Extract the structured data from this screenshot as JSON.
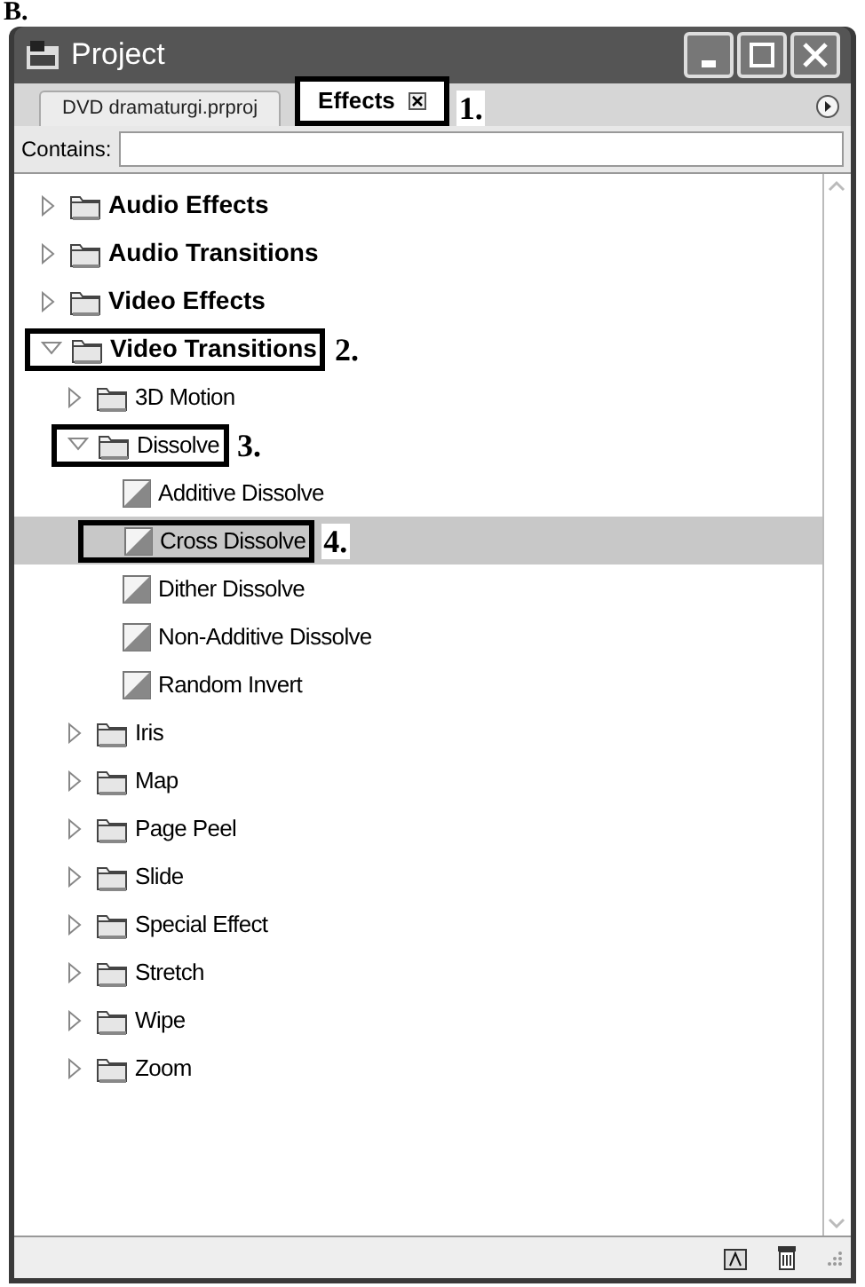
{
  "figure_label": "B.",
  "window": {
    "title": "Project"
  },
  "tabs": [
    {
      "label": "DVD dramaturgi.prproj",
      "selected": false,
      "closable": false
    },
    {
      "label": "Effects",
      "selected": true,
      "closable": true,
      "callout": "1."
    }
  ],
  "search": {
    "label": "Contains:"
  },
  "tree": [
    {
      "label": "Audio Effects",
      "kind": "folder",
      "expanded": false,
      "selected": false
    },
    {
      "label": "Audio Transitions",
      "kind": "folder",
      "expanded": false,
      "selected": false
    },
    {
      "label": "Video Effects",
      "kind": "folder",
      "expanded": false,
      "selected": false
    },
    {
      "label": "Video Transitions",
      "kind": "folder",
      "expanded": true,
      "selected": false,
      "callout": "2.",
      "children": [
        {
          "label": "3D Motion",
          "kind": "folder",
          "expanded": false,
          "selected": false
        },
        {
          "label": "Dissolve",
          "kind": "folder",
          "expanded": true,
          "selected": false,
          "callout": "3.",
          "children": [
            {
              "label": "Additive Dissolve",
              "kind": "effect",
              "selected": false
            },
            {
              "label": "Cross Dissolve",
              "kind": "effect",
              "selected": true,
              "callout": "4."
            },
            {
              "label": "Dither Dissolve",
              "kind": "effect",
              "selected": false
            },
            {
              "label": "Non-Additive Dissolve",
              "kind": "effect",
              "selected": false
            },
            {
              "label": "Random Invert",
              "kind": "effect",
              "selected": false
            }
          ]
        },
        {
          "label": "Iris",
          "kind": "folder",
          "expanded": false,
          "selected": false
        },
        {
          "label": "Map",
          "kind": "folder",
          "expanded": false,
          "selected": false
        },
        {
          "label": "Page Peel",
          "kind": "folder",
          "expanded": false,
          "selected": false
        },
        {
          "label": "Slide",
          "kind": "folder",
          "expanded": false,
          "selected": false
        },
        {
          "label": "Special Effect",
          "kind": "folder",
          "expanded": false,
          "selected": false
        },
        {
          "label": "Stretch",
          "kind": "folder",
          "expanded": false,
          "selected": false
        },
        {
          "label": "Wipe",
          "kind": "folder",
          "expanded": false,
          "selected": false
        },
        {
          "label": "Zoom",
          "kind": "folder",
          "expanded": false,
          "selected": false
        }
      ]
    }
  ]
}
